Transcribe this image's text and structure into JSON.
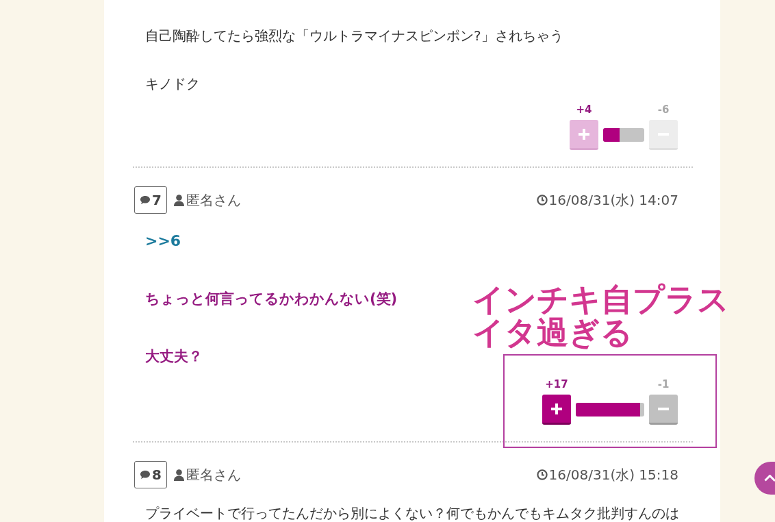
{
  "comments": [
    {
      "body": [
        {
          "kind": "plain",
          "text": "自己陶酔してたら強烈な「ウルトラマイナスピンポン?」されちゃう"
        },
        {
          "kind": "plain",
          "text": "キノドク"
        }
      ],
      "votes": {
        "plus": "+4",
        "minus": "-6",
        "level": 0.4,
        "dimmed": true
      }
    },
    {
      "number": "7",
      "author": "匿名さん",
      "date": "16/08/31(水) 14:07",
      "body": [
        {
          "kind": "anchor",
          "text": ">>6"
        },
        {
          "kind": "emphasis",
          "text": "ちょっと何言ってるかわかんない(笑)"
        },
        {
          "kind": "emphasis",
          "text": "大丈夫？"
        }
      ],
      "votes": {
        "plus": "+17",
        "minus": "-1",
        "level": 0.94,
        "dimmed": false
      }
    },
    {
      "number": "8",
      "author": "匿名さん",
      "date": "16/08/31(水) 15:18",
      "body": [
        {
          "kind": "plain",
          "text": "プライベートで行ってたんだから別によくない？何でもかんでもキムタク批判すんのは"
        }
      ]
    }
  ],
  "annotation": {
    "text": "インチキ自プラスイタ過ぎる",
    "highlight_frame": true
  }
}
